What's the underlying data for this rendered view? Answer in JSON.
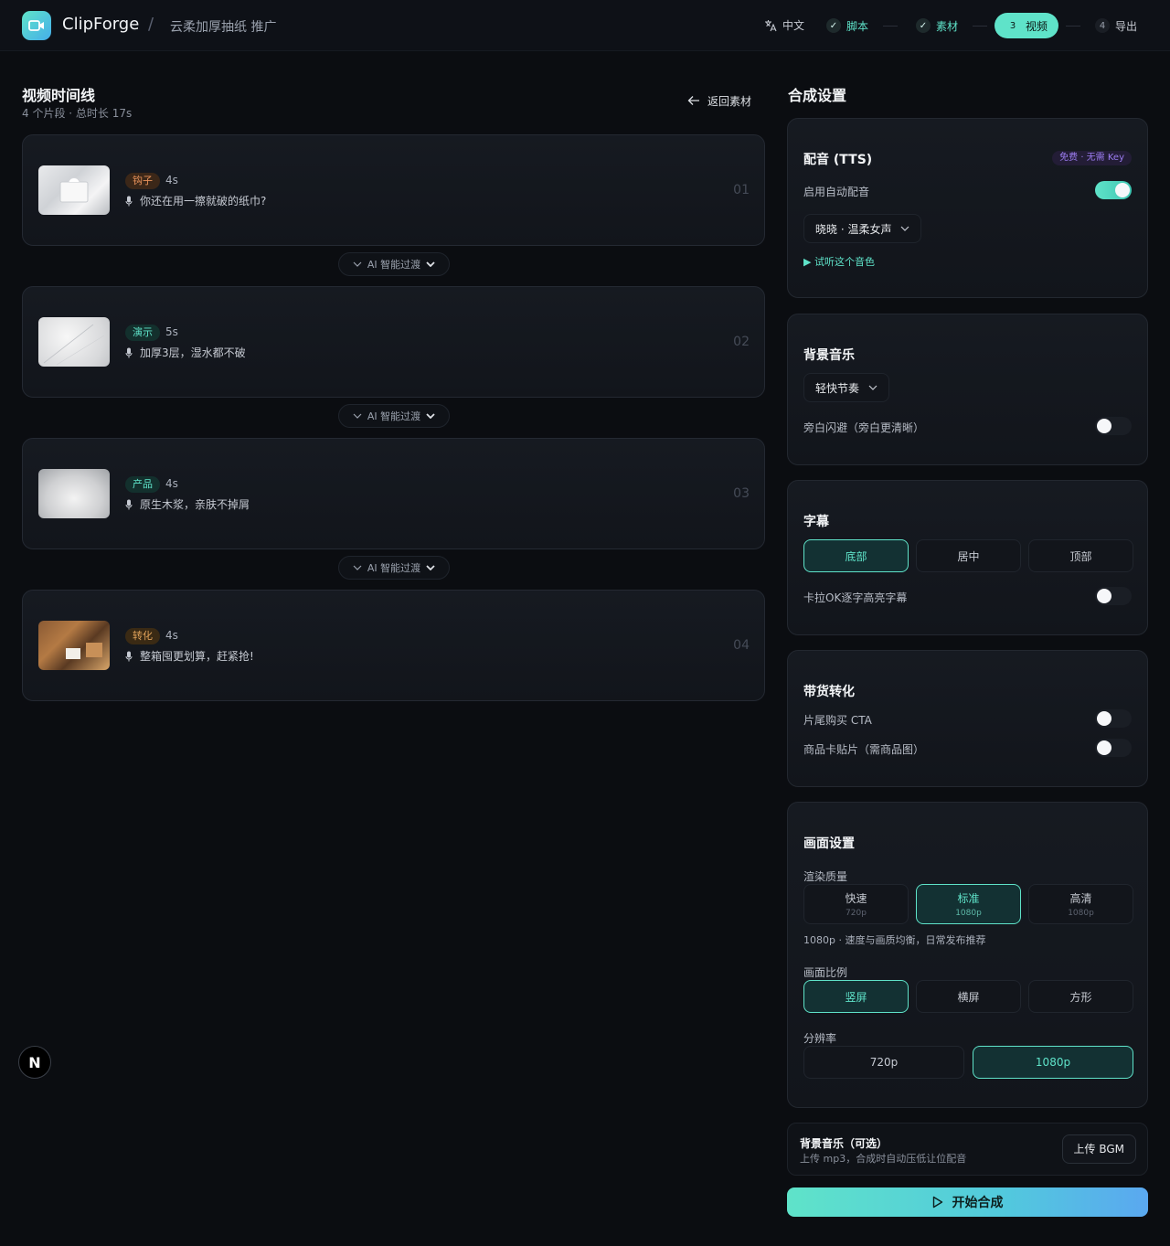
{
  "header": {
    "app_name": "ClipForge",
    "separator": "/",
    "project": "云柔加厚抽纸 推广",
    "lang": "中文",
    "steps": [
      {
        "index": "✓",
        "label": "脚本"
      },
      {
        "index": "✓",
        "label": "素材"
      },
      {
        "index": "3",
        "label": "视频"
      },
      {
        "index": "4",
        "label": "导出"
      }
    ]
  },
  "timeline": {
    "title": "视频时间线",
    "subtitle": "4 个片段 · 总时长 17s",
    "back": "返回素材",
    "transition": "AI 智能过渡",
    "clips": [
      {
        "tag": "钩子",
        "duration": "4s",
        "line": "你还在用一擦就破的纸巾?",
        "num": "01"
      },
      {
        "tag": "演示",
        "duration": "5s",
        "line": "加厚3层，湿水都不破",
        "num": "02"
      },
      {
        "tag": "产品",
        "duration": "4s",
        "line": "原生木浆，亲肤不掉屑",
        "num": "03"
      },
      {
        "tag": "转化",
        "duration": "4s",
        "line": "整箱囤更划算，赶紧抢!",
        "num": "04"
      }
    ]
  },
  "settings": {
    "title": "合成设置",
    "tts": {
      "title": "配音 (TTS)",
      "badge": "免费 · 无需 Key",
      "auto_label": "启用自动配音",
      "auto_on": true,
      "voice": "晓晓 · 温柔女声",
      "preview": "▶ 试听这个音色"
    },
    "music": {
      "title": "背景音乐",
      "track": "轻快节奏",
      "duck_label": "旁白闪避（旁白更清晰）",
      "duck_on": false
    },
    "subtitle": {
      "title": "字幕",
      "positions": [
        "底部",
        "居中",
        "顶部"
      ],
      "selected": "底部",
      "karaoke_label": "卡拉OK逐字高亮字幕",
      "karaoke_on": false
    },
    "commerce": {
      "title": "带货转化",
      "cta_label": "片尾购买 CTA",
      "cta_on": false,
      "card_label": "商品卡贴片（需商品图）",
      "card_on": false
    },
    "picture": {
      "title": "画面设置",
      "quality_label": "渲染质量",
      "qualities": [
        {
          "name": "快速",
          "res": "720p"
        },
        {
          "name": "标准",
          "res": "1080p"
        },
        {
          "name": "高清",
          "res": "1080p"
        }
      ],
      "quality_selected": "标准",
      "quality_desc": "1080p · 速度与画质均衡，日常发布推荐",
      "ratio_label": "画面比例",
      "ratios": [
        "竖屏",
        "横屏",
        "方形"
      ],
      "ratio_selected": "竖屏",
      "res_label": "分辨率",
      "resolutions": [
        "720p",
        "1080p"
      ],
      "res_selected": "1080p"
    },
    "bgm_upload": {
      "title": "背景音乐（可选）",
      "desc": "上传 mp3，合成时自动压低让位配音",
      "button": "上传 BGM"
    },
    "start": "开始合成"
  },
  "badge_letter": "N",
  "colors": {
    "accent": "#5fe3c9",
    "bg": "#0b0d11",
    "tag_hook": "#e8925a",
    "tag_demo": "#5fe3c9",
    "tag_convert": "#e0a25a",
    "badge_purple": "#9b7cf0"
  }
}
